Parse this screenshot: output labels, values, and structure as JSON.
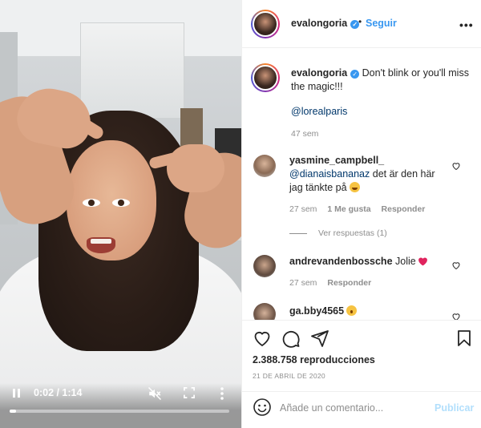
{
  "post": {
    "username": "evalongoria",
    "follow_label": "Seguir",
    "separator": "•",
    "more_label": "•••"
  },
  "caption": {
    "username": "evalongoria",
    "text": "Don't blink or you'll miss the magic!!!",
    "mention": "@lorealparis",
    "time": "47 sem"
  },
  "comments": [
    {
      "username": "yasmine_campbell_",
      "mention": "@dianaisbananaz",
      "text": "det är den här jag tänkte på",
      "emoji": "grinning-face-emoji",
      "time": "27 sem",
      "likes": "1 Me gusta",
      "reply_label": "Responder",
      "view_replies": "Ver respuestas (1)"
    },
    {
      "username": "andrevandenbossche",
      "text": "Jolie",
      "emoji": "red-heart-emoji",
      "time": "27 sem",
      "reply_label": "Responder"
    },
    {
      "username": "ga.bby4565",
      "text": "",
      "emoji": "surprised-face-emoji"
    }
  ],
  "video": {
    "time_display": "0:02 / 1:14",
    "progress": 0.03
  },
  "stats": {
    "views": "2.388.758 reproducciones",
    "date": "21 DE ABRIL DE 2020"
  },
  "add_comment": {
    "placeholder": "Añade un comentario...",
    "publish_label": "Publicar"
  },
  "colors": {
    "link": "#3897f0",
    "mention": "#00376b",
    "muted": "#8e8e8e",
    "publish_disabled": "#b2dffc",
    "heart": "#ed4956"
  },
  "icons": [
    "pause-icon",
    "mute-icon",
    "fullscreen-icon",
    "more-vertical-icon",
    "verified-icon",
    "more-horizontal-icon",
    "heart-icon",
    "comment-icon",
    "share-icon",
    "bookmark-icon",
    "emoji-icon"
  ]
}
